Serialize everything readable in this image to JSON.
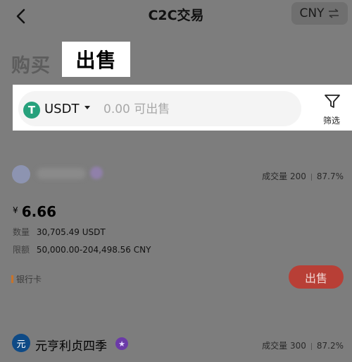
{
  "header": {
    "title": "C2C交易",
    "currency": "CNY"
  },
  "trade_tabs": {
    "buy": "购买",
    "sell": "出售",
    "active": "sell"
  },
  "filter_bar": {
    "asset": "USDT",
    "asset_logo_glyph": "T",
    "amount_placeholder": "0.00 可出售",
    "filter_label": "筛选"
  },
  "ads": [
    {
      "stats_label": "成交量 200",
      "completion": "87.7%",
      "currency_symbol": "¥",
      "price": "6.66",
      "quantity_label": "数量",
      "quantity_value": "30,705.49 USDT",
      "limit_label": "限额",
      "limit_value": "50,000.00-204,498.56 CNY",
      "payment_method": "银行卡",
      "action": "出售"
    },
    {
      "avatar_glyph": "元",
      "merchant_name": "元亨利贞四季",
      "stats_label": "成交量 300",
      "completion": "87.2%"
    }
  ],
  "colors": {
    "overlay": "#7d7d7d",
    "usdt_green": "#27a17c",
    "sell_button": "#b83f36"
  }
}
